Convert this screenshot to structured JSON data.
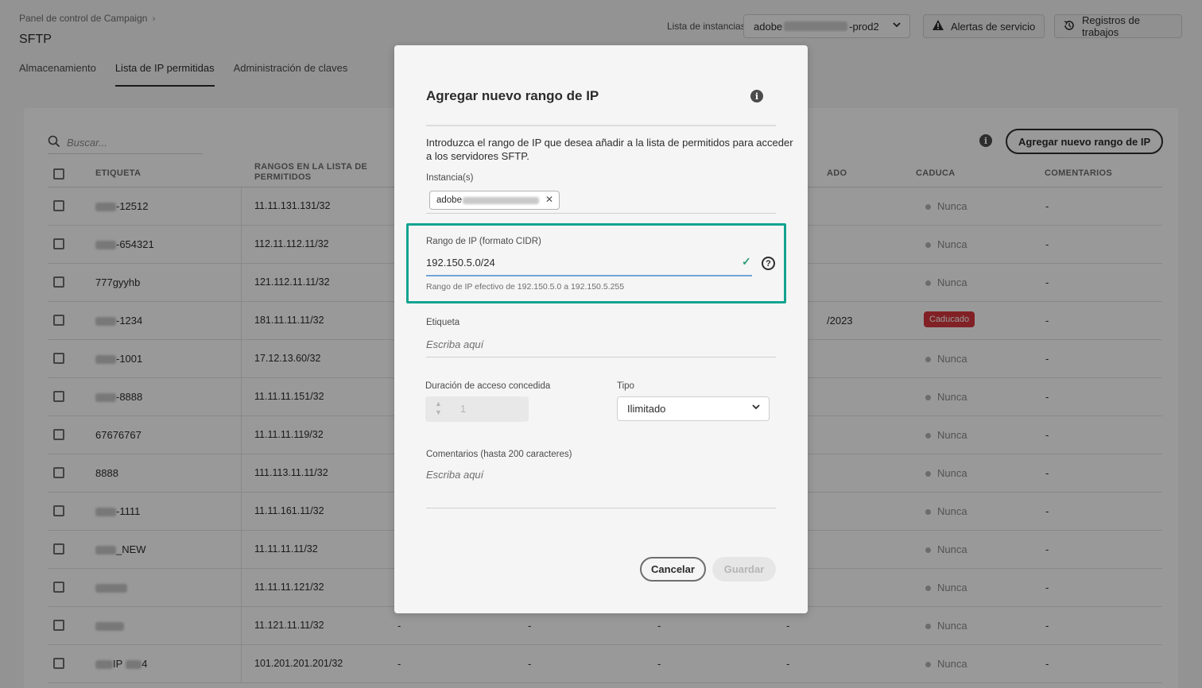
{
  "header": {
    "breadcrumb": "Panel de control de Campaign",
    "page_title": "SFTP",
    "tabs": [
      {
        "label": "Almacenamiento"
      },
      {
        "label": "Lista de IP permitidas"
      },
      {
        "label": "Administración de claves"
      }
    ],
    "instance_label": "Lista de instancias",
    "instance_prefix": "adobe",
    "instance_suffix": "-prod2",
    "alerts_label": "Alertas de servicio",
    "jobs_label": "Registros de trabajos"
  },
  "toolbar": {
    "search_placeholder": "Buscar...",
    "add_range_label": "Agregar nuevo rango de IP"
  },
  "table": {
    "columns": {
      "label": "ETIQUETA",
      "ranges": "RANGOS EN LA LISTA DE PERMITIDOS",
      "created": "ADO",
      "expires": "CADUCA",
      "comments": "COMENTARIOS"
    },
    "rows": [
      {
        "label": "-12512",
        "range": "11.11.131.131/32",
        "created": "",
        "expires": "Nunca",
        "comment": "-"
      },
      {
        "label": "-654321",
        "range": "112.11.112.11/32",
        "created": "",
        "expires": "Nunca",
        "comment": "-"
      },
      {
        "label": "777gyyhb",
        "range": "121.112.11.11/32",
        "created": "",
        "expires": "Nunca",
        "comment": "-"
      },
      {
        "label": "-1234",
        "range": "181.11.11.11/32",
        "created": "/2023",
        "expires": "Caducado",
        "comment": "-"
      },
      {
        "label": "-1001",
        "range": "17.12.13.60/32",
        "created": "",
        "expires": "Nunca",
        "comment": "-"
      },
      {
        "label": "-8888",
        "range": "11.11.11.151/32",
        "created": "",
        "expires": "Nunca",
        "comment": "-"
      },
      {
        "label": "67676767",
        "range": "11.11.11.119/32",
        "created": "",
        "expires": "Nunca",
        "comment": "-"
      },
      {
        "label": "8888",
        "range": "111.113.11.11/32",
        "created": "",
        "expires": "Nunca",
        "comment": "-"
      },
      {
        "label": "-1111",
        "range": "11.11.161.11/32",
        "created": "",
        "expires": "Nunca",
        "comment": "-"
      },
      {
        "label": "_NEW",
        "range": "11.11.11.11/32",
        "created": "",
        "expires": "Nunca",
        "comment": "-"
      },
      {
        "label": "",
        "range": "11.11.11.121/32",
        "created": "",
        "expires": "Nunca",
        "comment": "-"
      },
      {
        "label": "",
        "range": "11.121.11.11/32",
        "created": "",
        "expires": "Nunca",
        "comment": "-"
      },
      {
        "label": "IP",
        "range": "101.201.201.201/32",
        "created": "",
        "expires": "Nunca",
        "comment": "-"
      }
    ],
    "dash": "-"
  },
  "modal": {
    "title": "Agregar nuevo rango de IP",
    "description": "Introduzca el rango de IP que desea añadir a la lista de permitidos para acceder a los servidores SFTP.",
    "instances_label": "Instancia(s)",
    "instance_tag_prefix": "adobe",
    "cidr_label": "Rango de IP (formato CIDR)",
    "cidr_value": "192.150.5.0/24",
    "cidr_effective": "Rango de IP efectivo de 192.150.5.0 a 192.150.5.255",
    "label_label": "Etiqueta",
    "label_placeholder": "Escriba aquí",
    "duration_label": "Duración de acceso concedida",
    "duration_value": "1",
    "type_label": "Tipo",
    "type_value": "Ilimitado",
    "comments_label": "Comentarios (hasta 200 caracteres)",
    "comments_placeholder": "Escriba aquí",
    "cancel_label": "Cancelar",
    "save_label": "Guardar"
  },
  "colors": {
    "highlight": "#13a38f",
    "expired_badge": "#d7373f",
    "valid_check": "#2d9d78"
  }
}
